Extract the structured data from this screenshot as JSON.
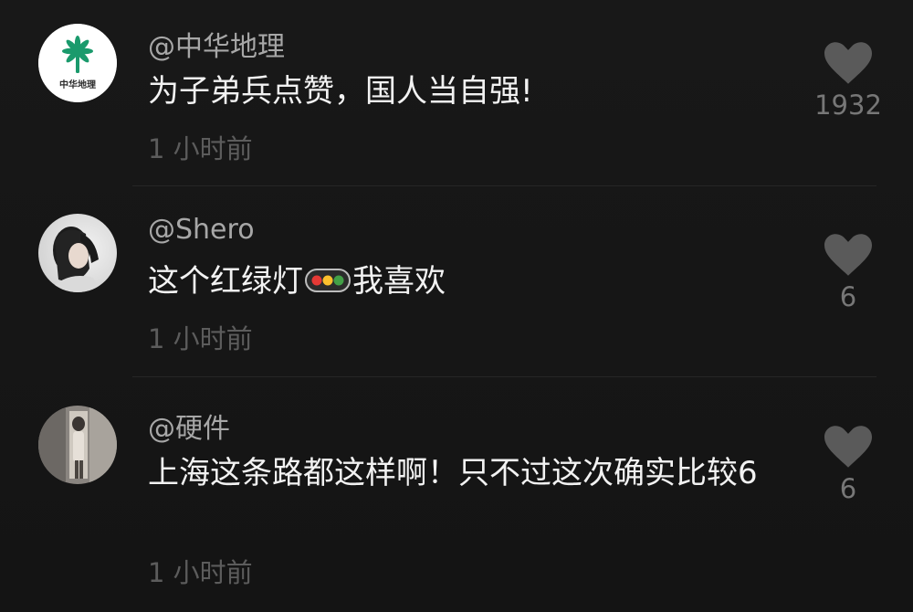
{
  "comments": [
    {
      "username": "@中华地理",
      "avatar_text": "中华地理",
      "text": "为子弟兵点赞，国人当自强!",
      "time": "1 小时前",
      "likes": "1932"
    },
    {
      "username": "@Shero",
      "text_before": "这个红绿灯",
      "emoji": "traffic-light-emoji",
      "text_after": "我喜欢",
      "time": "1 小时前",
      "likes": "6"
    },
    {
      "username": "@硬件",
      "text": "上海这条路都这样啊！只不过这次确实比较6",
      "time": "1 小时前",
      "likes": "6"
    }
  ],
  "colors": {
    "background": "#161616",
    "username": "#a7a7a7",
    "text": "#f2f2f2",
    "time": "#5c5c5c",
    "heart": "#5a5a5a",
    "logo_green": "#1a9a6c"
  }
}
